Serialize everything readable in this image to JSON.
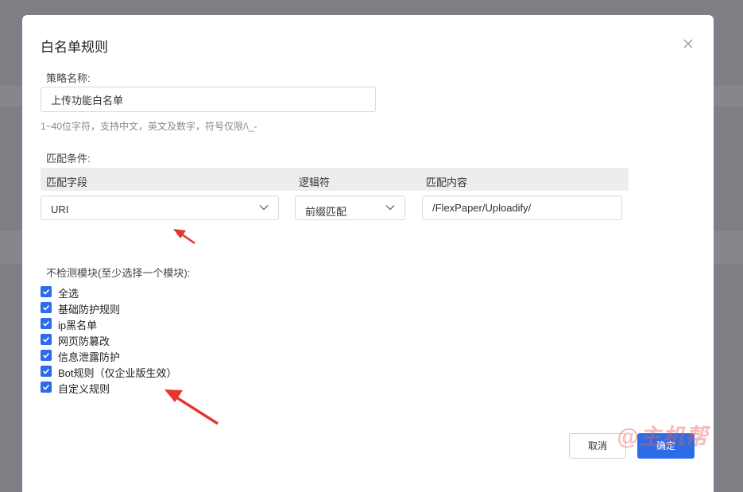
{
  "dialog": {
    "title": "白名单规则",
    "policy_name_label": "策略名称:",
    "policy_name_value": "上传功能白名单",
    "policy_name_hint": "1~40位字符，支持中文，英文及数字，符号仅限/\\_-",
    "match_condition_label": "匹配条件:",
    "match_table": {
      "headers": [
        "匹配字段",
        "逻辑符",
        "匹配内容"
      ],
      "field_value": "URI",
      "operator_value": "前缀匹配",
      "content_value": "/FlexPaper/Uploadify/"
    },
    "exclude_modules_label": "不检测模块(至少选择一个模块):",
    "modules": [
      {
        "label": "全选",
        "checked": true
      },
      {
        "label": "基础防护规则",
        "checked": true
      },
      {
        "label": "ip黑名单",
        "checked": true
      },
      {
        "label": "网页防篡改",
        "checked": true
      },
      {
        "label": "信息泄露防护",
        "checked": true
      },
      {
        "label": "Bot规则（仅企业版生效）",
        "checked": true
      },
      {
        "label": "自定义规则",
        "checked": true
      }
    ],
    "cancel_label": "取消",
    "confirm_label": "确定"
  },
  "watermark": "@主机帮",
  "colors": {
    "accent": "#2b6de6",
    "annotation_arrow": "#e8342f"
  }
}
